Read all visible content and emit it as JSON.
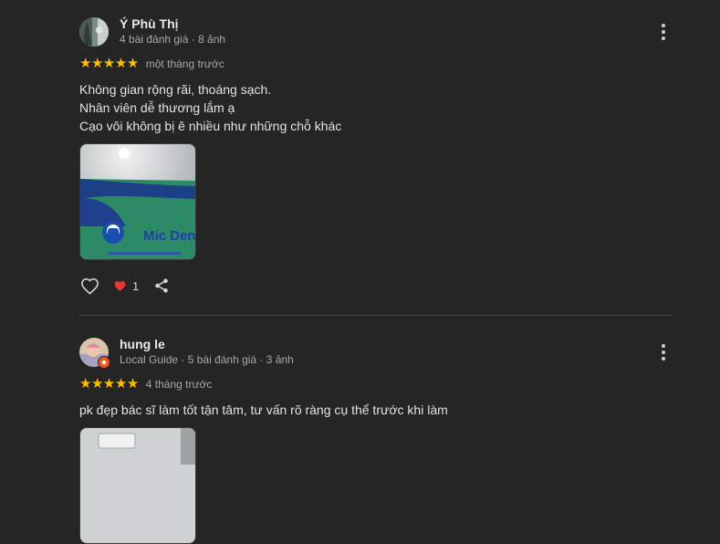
{
  "reviews": [
    {
      "author": "Ý Phù Thị",
      "meta": "4 bài đánh giá · 8 ảnh",
      "rating": 5,
      "when": "một tháng trước",
      "text": "Không gian rộng rãi, thoáng sạch.\nNhân viên dễ thương lắm ạ\nCạo vôi không bị ê nhiều như những chỗ khác",
      "photo_logo": "Mic Dental",
      "like_count": "1",
      "icons": {
        "like": "heart-outline-icon",
        "reaction": "red-heart-icon",
        "share": "share-icon",
        "more": "more-vert-icon"
      }
    },
    {
      "author": "hung le",
      "meta": "Local Guide · 5 bài đánh giá · 3 ảnh",
      "rating": 5,
      "when": "4 tháng trước",
      "text": "pk đẹp bác sĩ làm tốt tận tâm, tư vấn rõ ràng cụ thể trước khi làm"
    }
  ],
  "colors": {
    "background": "#252525",
    "star": "#fbbc04",
    "heart": "#e53935",
    "local_guide_badge": "#f4511e"
  }
}
